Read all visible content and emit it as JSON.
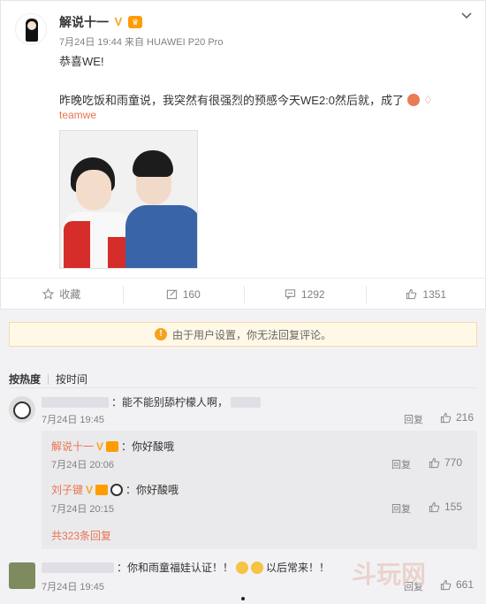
{
  "post": {
    "author": "解说十一",
    "meta": "7月24日 19:44 来自 HUAWEI P20 Pro",
    "text1": "恭喜WE!",
    "text2": "昨晚吃饭和雨童说，我突然有很强烈的预感今天WE2:0然后就，成了",
    "tag": "teamwe",
    "actions": [
      {
        "label": "收藏"
      },
      {
        "label": "160"
      },
      {
        "label": "1292"
      },
      {
        "label": "1351"
      }
    ]
  },
  "notice": "由于用户设置，你无法回复评论。",
  "sort": {
    "hot": "按热度",
    "time": "按时间"
  },
  "comments": [
    {
      "text_suffix": "：能不能别舔柠檬人啊，",
      "date": "7月24日 19:45",
      "reply": "回复",
      "likes": "216",
      "sub_comments": [
        {
          "author": "解说十一",
          "text": "：你好酸哦",
          "date": "7月24日 20:06",
          "reply": "回复",
          "likes": "770"
        },
        {
          "author": "刘子键",
          "text": "：你好酸哦",
          "date": "7月24日 20:15",
          "reply": "回复",
          "likes": "155"
        }
      ],
      "more": "共323条回复"
    },
    {
      "text_a": "：你和雨童福娃认证！！",
      "text_b": "以后常来！！",
      "date": "7月24日 19:45",
      "reply": "回复",
      "likes": "661"
    }
  ],
  "watermark": "斗玩网",
  "colors": {
    "accent": "#eb7350",
    "notice_bg": "#fff8e6",
    "panel_bg": "#f2f2f5"
  }
}
